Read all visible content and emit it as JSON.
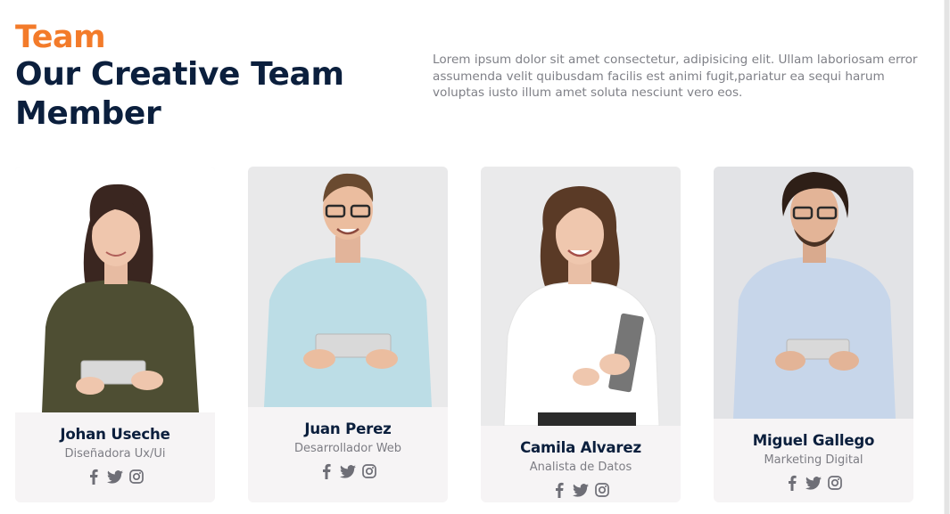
{
  "header": {
    "eyebrow": "Team",
    "title": "Our Creative Team Member",
    "description": "Lorem ipsum dolor sit amet consectetur, adipisicing elit. Ullam laboriosam error assumenda velit quibusdam facilis est animi fugit,pariatur ea sequi harum voluptas iusto illum amet soluta nesciunt vero eos."
  },
  "team": [
    {
      "name": "Johan Useche",
      "role": "Diseñadora Ux/Ui"
    },
    {
      "name": "Juan Perez",
      "role": "Desarrollador Web"
    },
    {
      "name": "Camila Alvarez",
      "role": "Analista de Datos"
    },
    {
      "name": "Miguel Gallego",
      "role": "Marketing Digital"
    }
  ],
  "social_icons": [
    "facebook-icon",
    "twitter-icon",
    "instagram-icon"
  ],
  "colors": {
    "accent": "#f37b2a",
    "heading": "#0b1f3d",
    "card_bg": "#f6f4f5",
    "icon": "#6e6e76"
  }
}
